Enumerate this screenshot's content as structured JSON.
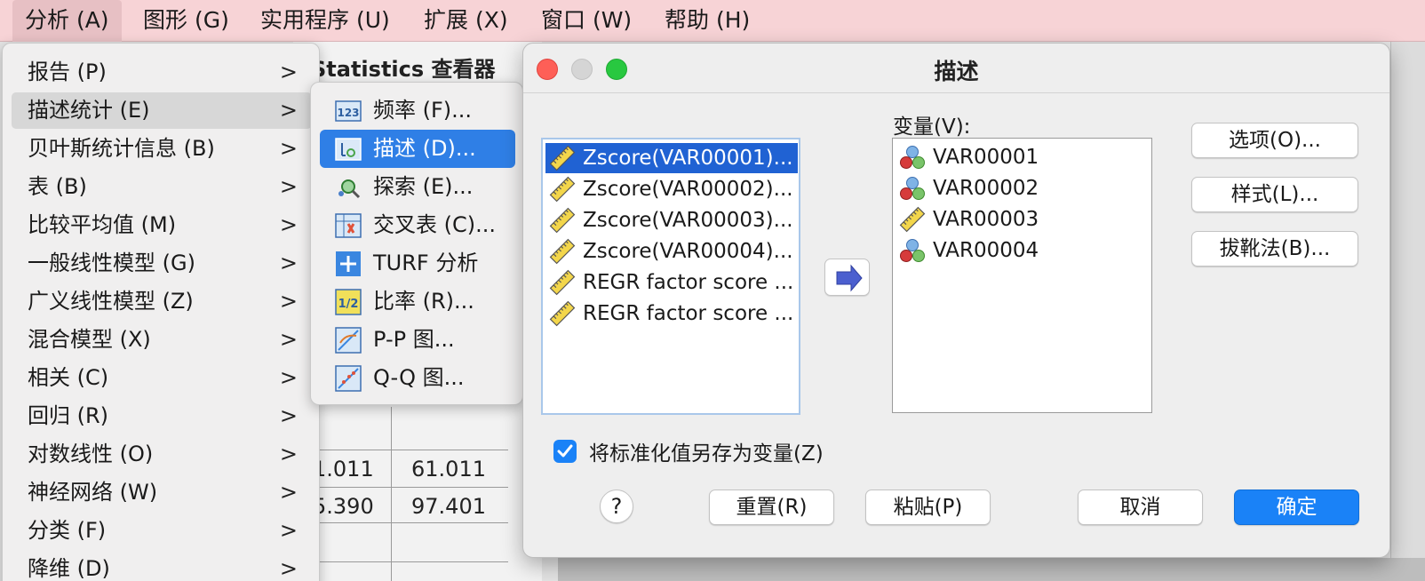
{
  "menubar": {
    "items": [
      "分析 (A)",
      "图形 (G)",
      "实用程序 (U)",
      "扩展 (X)",
      "窗口 (W)",
      "帮助 (H)"
    ]
  },
  "background": {
    "viewer_title": "Statistics 查看器",
    "cells": [
      "1.011",
      "61.011",
      "5.390",
      "97.401"
    ]
  },
  "analyze_menu": {
    "items": [
      "报告 (P)",
      "描述统计 (E)",
      "贝叶斯统计信息 (B)",
      "表 (B)",
      "比较平均值 (M)",
      "一般线性模型 (G)",
      "广义线性模型 (Z)",
      "混合模型 (X)",
      "相关 (C)",
      "回归 (R)",
      "对数线性 (O)",
      "神经网络 (W)",
      "分类 (F)",
      "降维 (D)"
    ]
  },
  "descriptive_menu": {
    "items": [
      {
        "label": "频率 (F)...",
        "icon": "frequencies-icon"
      },
      {
        "label": "描述 (D)...",
        "icon": "descriptives-icon"
      },
      {
        "label": "探索 (E)...",
        "icon": "explore-icon"
      },
      {
        "label": "交叉表 (C)...",
        "icon": "crosstabs-icon"
      },
      {
        "label": "TURF 分析",
        "icon": "turf-icon"
      },
      {
        "label": "比率 (R)...",
        "icon": "ratio-icon"
      },
      {
        "label": "P-P 图...",
        "icon": "pp-plot-icon"
      },
      {
        "label": "Q-Q 图...",
        "icon": "qq-plot-icon"
      }
    ],
    "selected_index": 1
  },
  "dialog": {
    "title": "描述",
    "source_list": [
      "Zscore(VAR00001)...",
      "Zscore(VAR00002)...",
      "Zscore(VAR00003)...",
      "Zscore(VAR00004)...",
      "REGR factor score ...",
      "REGR factor score ..."
    ],
    "variables_label": "变量(V):",
    "variables": [
      {
        "name": "VAR00001",
        "icon": "nominal-icon"
      },
      {
        "name": "VAR00002",
        "icon": "nominal-icon"
      },
      {
        "name": "VAR00003",
        "icon": "scale-icon"
      },
      {
        "name": "VAR00004",
        "icon": "nominal-icon"
      }
    ],
    "side_buttons": [
      "选项(O)...",
      "样式(L)...",
      "拔靴法(B)..."
    ],
    "checkbox_label": "将标准化值另存为变量(Z)",
    "checkbox_checked": true,
    "help_label": "?",
    "bottom_buttons": {
      "reset": "重置(R)",
      "paste": "粘贴(P)",
      "cancel": "取消",
      "ok": "确定"
    }
  },
  "colors": {
    "menubar_bg": "#f7d3d6",
    "accent": "#1a82f7",
    "selection": "#2062d3"
  }
}
